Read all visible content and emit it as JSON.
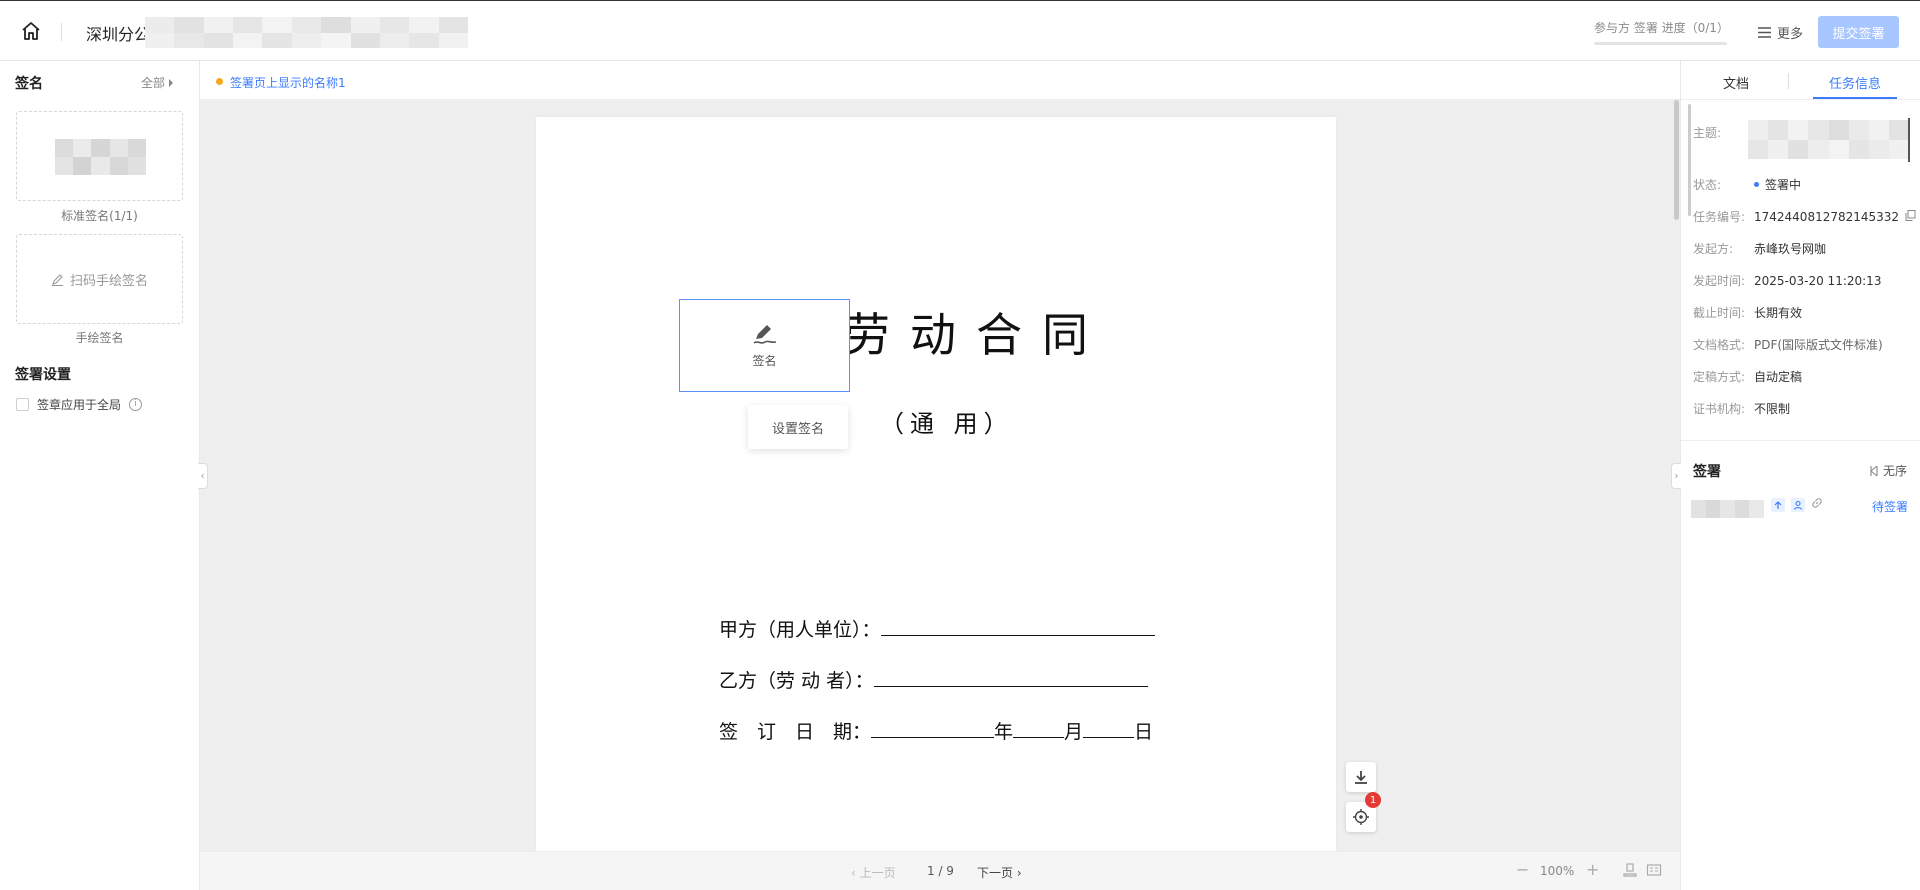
{
  "header": {
    "doc_title": "深圳分公",
    "progress_text": "参与方 签署 进度（0/1）",
    "progress_fraction": 0,
    "more_label": "更多",
    "submit_label": "提交签署"
  },
  "left": {
    "signature_heading": "签名",
    "all_label": "全部",
    "standard_caption": "标准签名(1/1)",
    "handwritten_button": "扫码手绘签名",
    "handwritten_caption": "手绘签名",
    "settings_heading": "签署设置",
    "apply_global_label": "签章应用于全局"
  },
  "center": {
    "notice": "签署页上显示的名称1",
    "contract_title": "劳动合同",
    "contract_subtitle": "（通 用）",
    "party_a": "甲方（用人单位）：",
    "party_b": "乙方（劳 动 者）：",
    "sign_date": "签　订　日　期：",
    "year": "年",
    "month": "月",
    "day": "日",
    "sign_box_label": "签名",
    "set_signature": "设置签名",
    "locate_badge": "1",
    "prev_page": "上一页",
    "page_indicator": "1 / 9",
    "next_page": "下一页",
    "zoom": "100%"
  },
  "right": {
    "tab_document": "文档",
    "tab_task_info": "任务信息",
    "subject_label": "主题:",
    "status_label": "状态:",
    "status_value": "签署中",
    "task_no_label": "任务编号:",
    "task_no_value": "1742440812782145332",
    "initiator_label": "发起方:",
    "initiator_value": "赤峰玖号网咖",
    "start_time_label": "发起时间:",
    "start_time_value": "2025-03-20 11:20:13",
    "deadline_label": "截止时间:",
    "deadline_value": "长期有效",
    "format_label": "文档格式:",
    "format_value": "PDF(国际版式文件标准)",
    "finalize_label": "定稿方式:",
    "finalize_value": "自动定稿",
    "ca_label": "证书机构:",
    "ca_value": "不限制",
    "sign_heading": "签署",
    "order_label": "无序",
    "signer_status": "待签署"
  },
  "colors": {
    "accent": "#3b7cff",
    "submit_disabled": "#a8c6ff",
    "notice_dot": "#f5a623",
    "badge": "#e53935"
  }
}
